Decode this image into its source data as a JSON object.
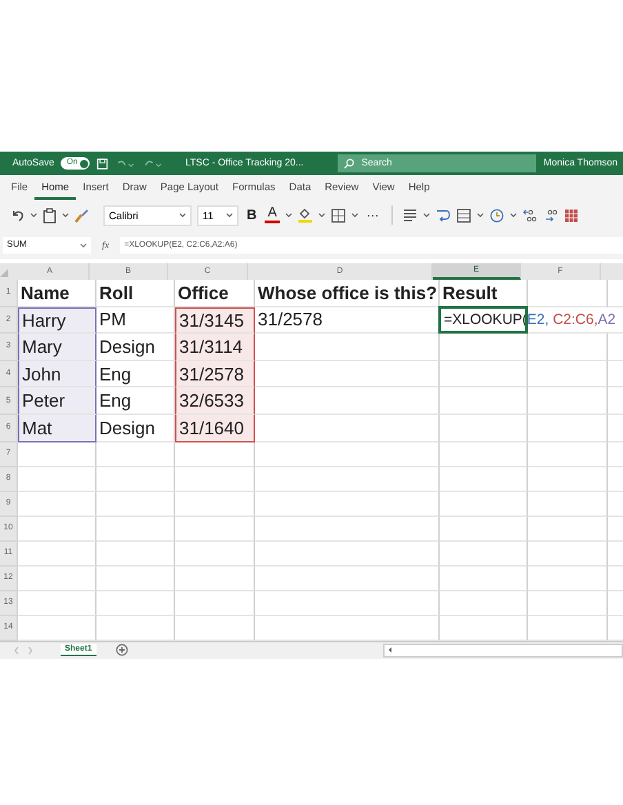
{
  "title_bar": {
    "autosave_label": "AutoSave",
    "autosave_toggle": {
      "label": "On",
      "on": true
    },
    "document_title": "LTSC - Office Tracking 20...",
    "search": {
      "placeholder": "Search"
    },
    "user": "Monica Thomson"
  },
  "menu": [
    {
      "label": "File",
      "selected": false
    },
    {
      "label": "Home",
      "selected": true
    },
    {
      "label": "Insert",
      "selected": false
    },
    {
      "label": "Draw",
      "selected": false
    },
    {
      "label": "Page Layout",
      "selected": false
    },
    {
      "label": "Formulas",
      "selected": false
    },
    {
      "label": "Data",
      "selected": false
    },
    {
      "label": "Review",
      "selected": false
    },
    {
      "label": "View",
      "selected": false
    },
    {
      "label": "Help",
      "selected": false
    }
  ],
  "toolbar": {
    "font": "Calibri",
    "font_size": "11",
    "bold": "B",
    "underline_color": "A",
    "more": "···"
  },
  "formula_bar": {
    "name_box": "SUM",
    "fx": "fx",
    "formula": "=XLOOKUP(E2, C2:C6,A2:A6)"
  },
  "columns": [
    {
      "label": "A",
      "selected": false
    },
    {
      "label": "B",
      "selected": false
    },
    {
      "label": "C",
      "selected": false
    },
    {
      "label": "D",
      "selected": false
    },
    {
      "label": "E",
      "selected": true
    },
    {
      "label": "F",
      "selected": false
    }
  ],
  "rows": [
    {
      "number": "1",
      "cells": [
        {
          "text": "Name",
          "bold": true
        },
        {
          "text": "Roll",
          "bold": true
        },
        {
          "text": "Office",
          "bold": true
        },
        {
          "text": "Whose office is this?",
          "bold": true
        },
        {
          "text": "Result",
          "bold": true
        },
        {}
      ]
    },
    {
      "number": "2",
      "cells": [
        {
          "text": "Harry",
          "color": "#7b6fb5"
        },
        {
          "text": "PM"
        },
        {
          "text": "31/3145",
          "color": "#d0504f"
        },
        {
          "text": "31/2578"
        },
        {
          "kind": "formula",
          "parts": [
            {
              "text": "=XLOOKUP(",
              "color": "#222222"
            },
            {
              "text": "E2,",
              "color": "#3b6fb6"
            },
            {
              "text": " C2:C6,",
              "color": "#c0504d"
            },
            {
              "text": "A2",
              "color": "#7b6fb5"
            }
          ]
        },
        {}
      ]
    },
    {
      "number": "3",
      "cells": [
        {
          "text": "Mary",
          "color": "#7b6fb5"
        },
        {
          "text": "Design"
        },
        {
          "text": "31/3114",
          "color": "#d0504f"
        },
        {},
        {},
        {}
      ]
    },
    {
      "number": "4",
      "cells": [
        {
          "text": "John",
          "color": "#7b6fb5"
        },
        {
          "text": "Eng"
        },
        {
          "text": "31/2578",
          "color": "#d0504f"
        },
        {},
        {},
        {}
      ]
    },
    {
      "number": "5",
      "cells": [
        {
          "text": "Peter",
          "color": "#7b6fb5"
        },
        {
          "text": "Eng"
        },
        {
          "text": "32/6533",
          "color": "#d0504f"
        },
        {},
        {},
        {}
      ]
    },
    {
      "number": "6",
      "cells": [
        {
          "text": "Mat",
          "color": "#7b6fb5"
        },
        {
          "text": "Design"
        },
        {
          "text": "31/1640",
          "color": "#d0504f"
        },
        {},
        {},
        {}
      ]
    },
    {
      "number": "7"
    },
    {
      "number": "8"
    },
    {
      "number": "9"
    },
    {
      "number": "10"
    },
    {
      "number": "11"
    },
    {
      "number": "12"
    },
    {
      "number": "13"
    },
    {
      "number": "14"
    }
  ],
  "sheets": [
    {
      "label": "Sheet1",
      "selected": true
    }
  ]
}
